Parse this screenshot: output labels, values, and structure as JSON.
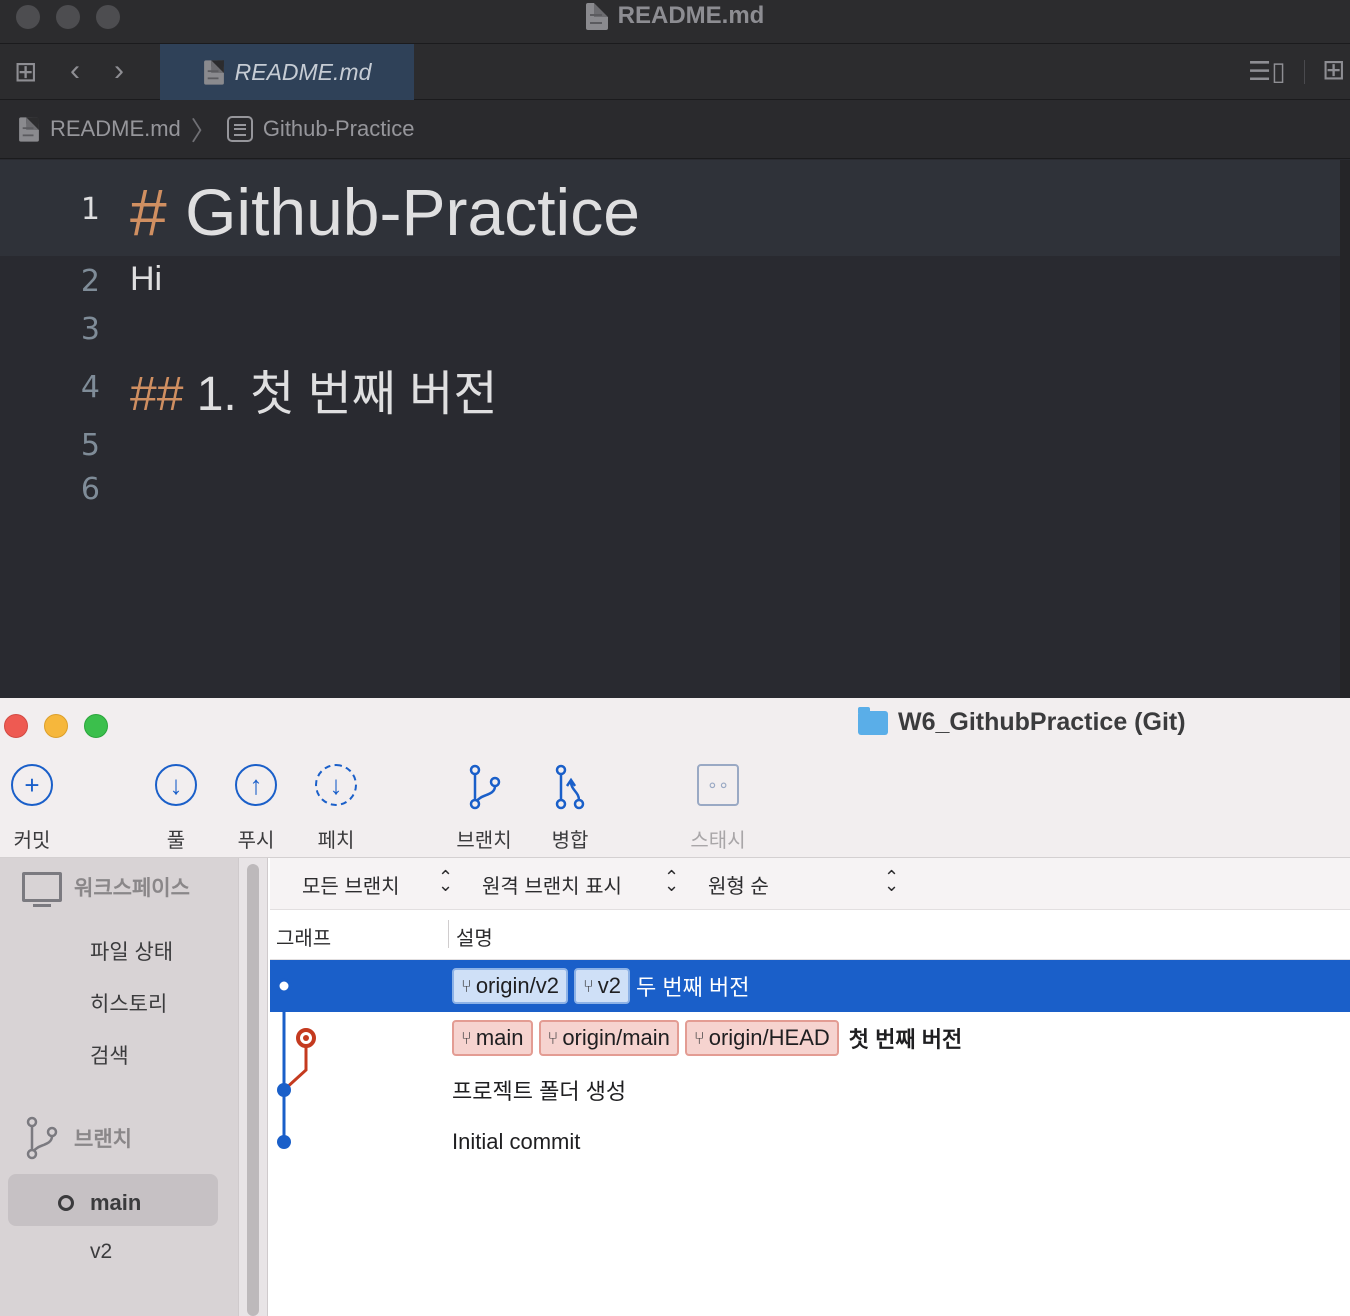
{
  "xcode": {
    "window_title": "README.md",
    "tab_label": "README.md",
    "breadcrumb": {
      "file": "README.md",
      "section": "Github-Practice"
    },
    "lines": [
      {
        "number": "1",
        "marker": "#",
        "text": "Github-Practice"
      },
      {
        "number": "2",
        "marker": "",
        "text": "Hi"
      },
      {
        "number": "3",
        "marker": "",
        "text": ""
      },
      {
        "number": "4",
        "marker": "##",
        "text": "1. 첫 번째 버전"
      },
      {
        "number": "5",
        "marker": "",
        "text": ""
      },
      {
        "number": "6",
        "marker": "",
        "text": ""
      }
    ]
  },
  "sourcetree": {
    "window_title": "W6_GithubPractice (Git)",
    "toolbar": {
      "commit": "커밋",
      "pull": "풀",
      "push": "푸시",
      "fetch": "페치",
      "branch": "브랜치",
      "merge": "병합",
      "stash": "스태시"
    },
    "sidebar": {
      "workspace_header": "워크스페이스",
      "workspace_items": [
        "파일 상태",
        "히스토리",
        "검색"
      ],
      "branches_header": "브랜치",
      "branches": [
        "main",
        "v2"
      ],
      "current_branch": "main"
    },
    "filters": {
      "branches": "모든 브랜치",
      "remote": "원격 브랜치 표시",
      "order": "원형 순"
    },
    "columns": {
      "graph": "그래프",
      "description": "설명"
    },
    "commits": [
      {
        "tags": [
          {
            "label": "origin/v2",
            "kind": "remote"
          },
          {
            "label": "v2",
            "kind": "local"
          }
        ],
        "message": "두 번째 버전",
        "selected": true
      },
      {
        "tags": [
          {
            "label": "main",
            "kind": "head"
          },
          {
            "label": "origin/main",
            "kind": "head"
          },
          {
            "label": "origin/HEAD",
            "kind": "head"
          }
        ],
        "message": "첫 번째 버전",
        "selected": false
      },
      {
        "tags": [],
        "message": "프로젝트 폴더 생성",
        "selected": false
      },
      {
        "tags": [],
        "message": "Initial commit",
        "selected": false
      }
    ],
    "colors": {
      "selection": "#1a5fc9",
      "graph_blue": "#1a5fc9",
      "graph_red": "#c43a1f"
    }
  }
}
